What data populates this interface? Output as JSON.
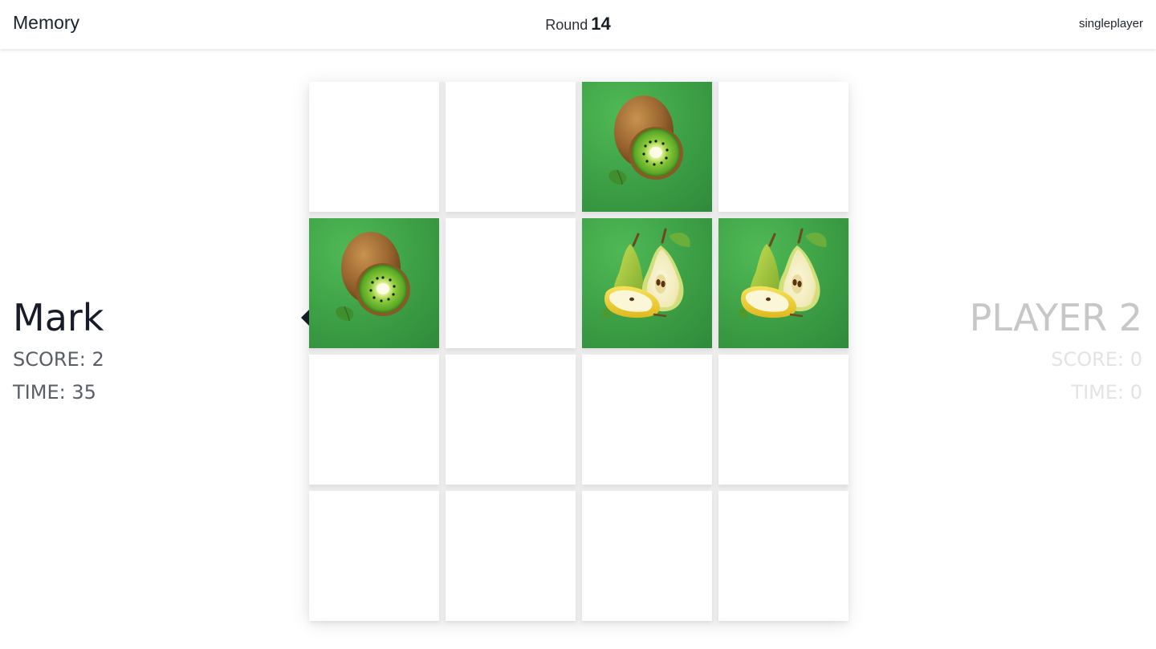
{
  "header": {
    "app_title": "Memory",
    "round_label": "Round",
    "round_number": "14",
    "mode": "singleplayer"
  },
  "players": [
    {
      "name": "Mark",
      "score_text": "SCORE: 2",
      "time_text": "TIME: 35",
      "active": true
    },
    {
      "name": "PLAYER 2",
      "score_text": "SCORE: 0",
      "time_text": "TIME: 0",
      "active": false
    }
  ],
  "board": {
    "rows": 4,
    "cols": 4,
    "cards": [
      {
        "face": "hidden"
      },
      {
        "face": "hidden"
      },
      {
        "face": "kiwi-icon"
      },
      {
        "face": "hidden"
      },
      {
        "face": "kiwi-icon"
      },
      {
        "face": "hidden"
      },
      {
        "face": "pear-icon"
      },
      {
        "face": "pear-icon"
      },
      {
        "face": "hidden"
      },
      {
        "face": "hidden"
      },
      {
        "face": "hidden"
      },
      {
        "face": "hidden"
      },
      {
        "face": "hidden"
      },
      {
        "face": "hidden"
      },
      {
        "face": "hidden"
      },
      {
        "face": "hidden"
      }
    ]
  },
  "colors": {
    "card_face_green": "#3c9e45",
    "active_text": "#171c28",
    "inactive_text": "#c7c7c7"
  }
}
